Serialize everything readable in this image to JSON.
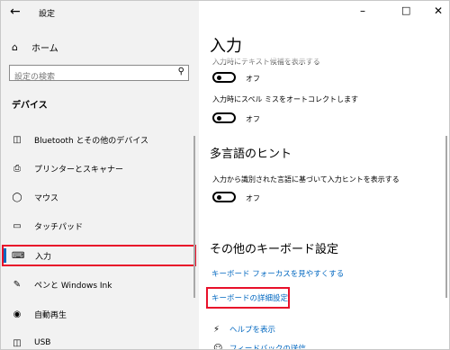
{
  "window": {
    "title": "設定",
    "back_icon": "arrow-left-icon",
    "controls": [
      "minimize-icon",
      "maximize-icon",
      "close-icon"
    ]
  },
  "sidebar": {
    "home_label": "ホーム",
    "search_placeholder": "設定の検索",
    "section_title": "デバイス",
    "items": [
      {
        "label": "Bluetooth とその他のデバイス",
        "icon": "bluetooth-devices-icon"
      },
      {
        "label": "プリンターとスキャナー",
        "icon": "printer-icon"
      },
      {
        "label": "マウス",
        "icon": "mouse-icon"
      },
      {
        "label": "タッチパッド",
        "icon": "touchpad-icon"
      },
      {
        "label": "入力",
        "icon": "keyboard-icon",
        "selected": true
      },
      {
        "label": "ペンと Windows Ink",
        "icon": "pen-icon"
      },
      {
        "label": "自動再生",
        "icon": "autoplay-icon"
      },
      {
        "label": "USB",
        "icon": "usb-icon"
      }
    ]
  },
  "main": {
    "title": "入力",
    "cut_off_option": "入力時にテキスト候補を表示する",
    "toggle1_state": "オフ",
    "spell_label": "入力時にスペル ミスをオートコレクトします",
    "toggle2_state": "オフ",
    "multilang_heading": "多言語のヒント",
    "multilang_label": "入力から識別された言語に基づいて入力ヒントを表示する",
    "toggle3_state": "オフ",
    "other_heading": "その他のキーボード設定",
    "link_focus": "キーボード フォーカスを見やすくする",
    "link_advanced": "キーボードの詳細設定",
    "help_label": "ヘルプを表示",
    "feedback_label": "フィードバックの送信"
  },
  "colors": {
    "accent": "#0067c0",
    "highlight_box": "#e8102a",
    "sidebar_bg": "#f2f2f2"
  }
}
